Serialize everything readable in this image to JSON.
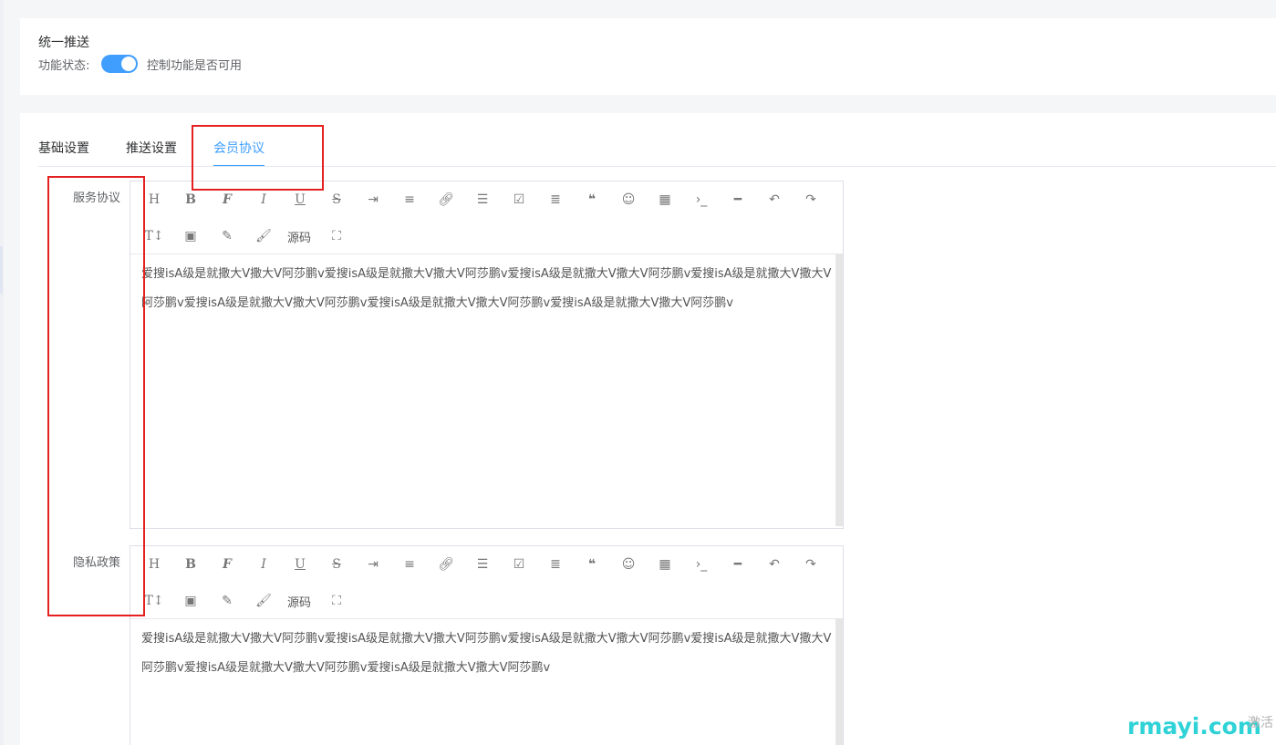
{
  "top_card": {
    "title": "统一推送",
    "status_label": "功能状态:",
    "toggle_on": true,
    "toggle_desc": "控制功能是否可用"
  },
  "tabs": [
    {
      "label": "基础设置",
      "active": false
    },
    {
      "label": "推送设置",
      "active": false
    },
    {
      "label": "会员协议",
      "active": true
    }
  ],
  "toolbar_icons": [
    "heading-icon",
    "bold-icon",
    "font-icon",
    "italic-icon",
    "underline-icon",
    "strikethrough-icon",
    "indent-icon",
    "line-height-icon",
    "link-icon",
    "list-icon",
    "checkbox-icon",
    "align-icon",
    "quote-icon",
    "emoji-icon",
    "table-icon",
    "code-icon",
    "divider-icon",
    "undo-icon",
    "redo-icon",
    "font-size-icon",
    "image-icon",
    "pen-icon",
    "brush-icon",
    "source-icon",
    "fullscreen-icon"
  ],
  "editors": {
    "service": {
      "label": "服务协议",
      "source_label": "源码",
      "content": "爱搜isA级是就撒大V撒大V阿莎鹏v爱搜isA级是就撒大V撒大V阿莎鹏v爱搜isA级是就撒大V撒大V阿莎鹏v爱搜isA级是就撒大V撒大V阿莎鹏v爱搜isA级是就撒大V撒大V阿莎鹏v爱搜isA级是就撒大V撒大V阿莎鹏v爱搜isA级是就撒大V撒大V阿莎鹏v"
    },
    "privacy": {
      "label": "隐私政策",
      "source_label": "源码",
      "content": "爱搜isA级是就撒大V撒大V阿莎鹏v爱搜isA级是就撒大V撒大V阿莎鹏v爱搜isA级是就撒大V撒大V阿莎鹏v爱搜isA级是就撒大V撒大V阿莎鹏v爱搜isA级是就撒大V撒大V阿莎鹏v爱搜isA级是就撒大V撒大V阿莎鹏v"
    }
  },
  "watermark": "rmayi.com",
  "watermark_side": "激活",
  "colors": {
    "accent": "#409eff",
    "highlight_box": "#e42020",
    "watermark": "#2fd3d7"
  }
}
